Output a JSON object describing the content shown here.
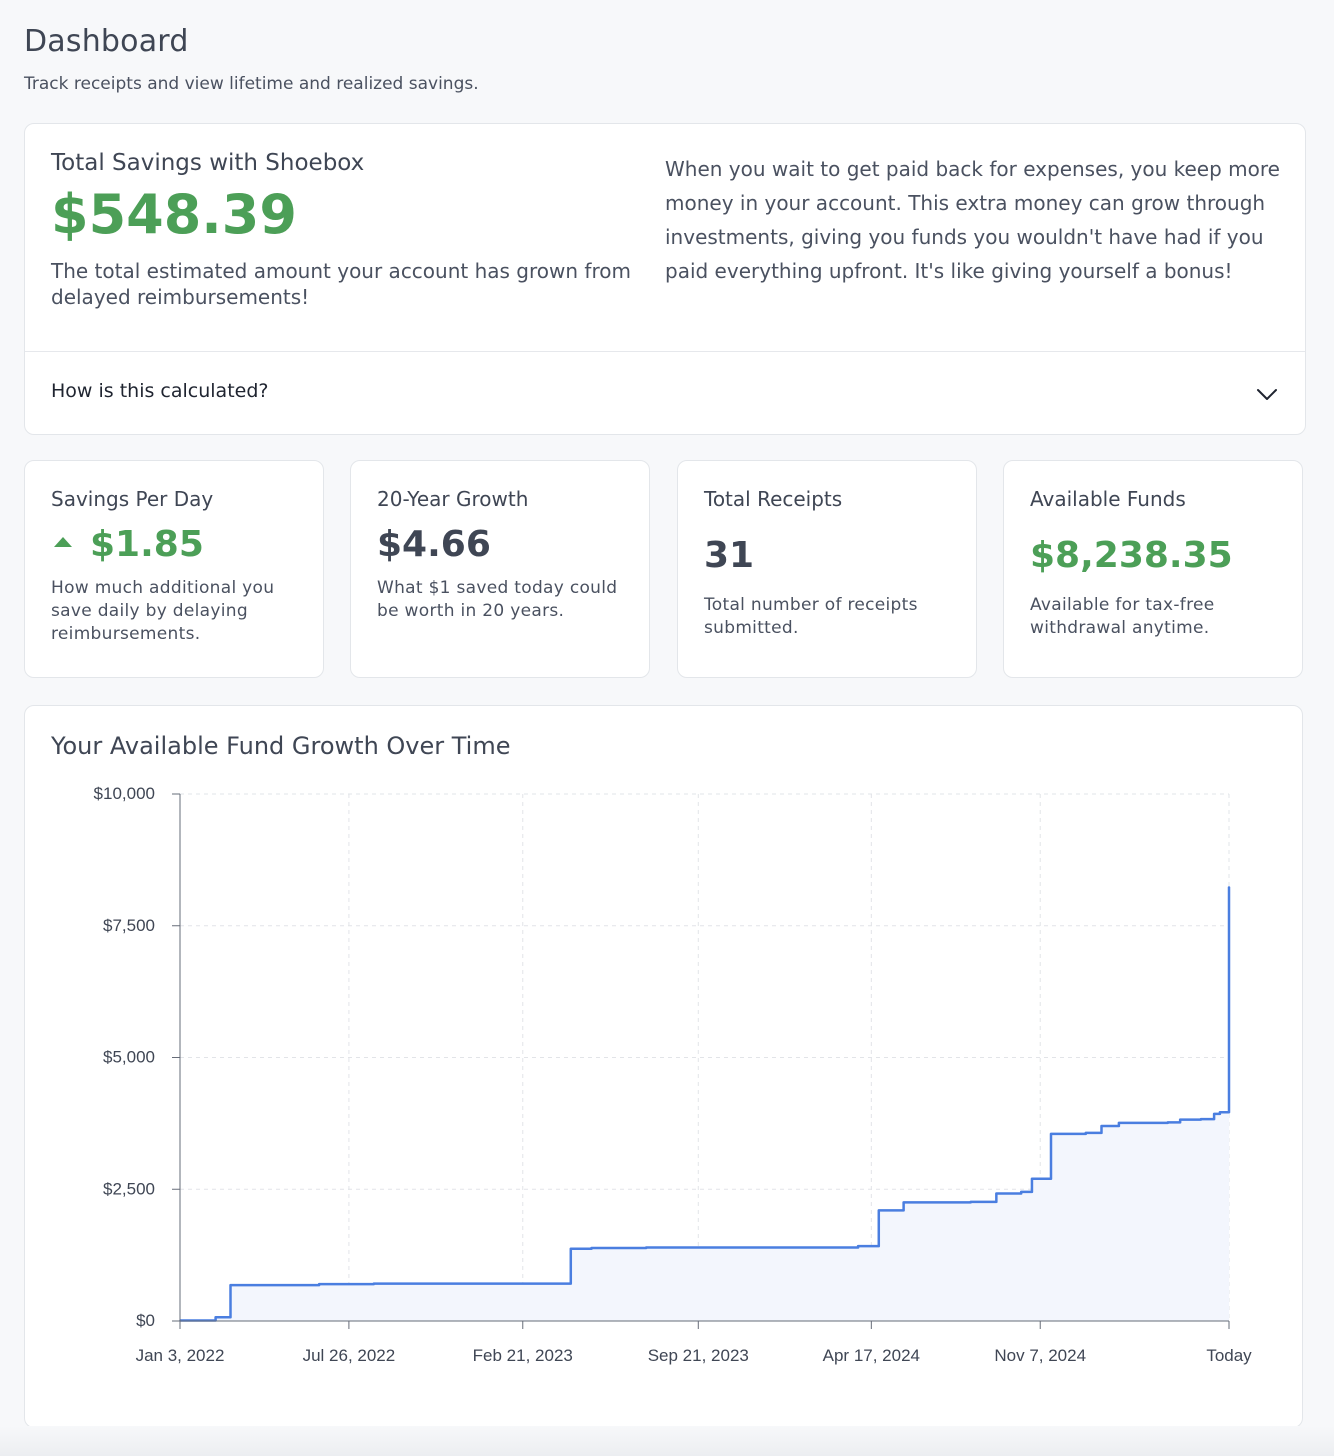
{
  "page": {
    "title": "Dashboard",
    "subtitle": "Track receipts and view lifetime and realized savings."
  },
  "hero": {
    "heading": "Total Savings with Shoebox",
    "amount": "$548.39",
    "description": "The total estimated amount your account has grown from delayed reimbursements!",
    "explanation": "When you wait to get paid back for expenses, you keep more money in your account. This extra money can grow through investments, giving you funds you wouldn't have had if you paid everything upfront. It's like giving yourself a bonus!",
    "accordion_label": "How is this calculated?",
    "accordion_icon": "chevron-down-icon"
  },
  "stats": [
    {
      "title": "Savings Per Day",
      "value": "$1.85",
      "description": "How much additional you save daily by delaying reimbursements.",
      "icon": "arrow-up-icon",
      "color": "#4c9f57"
    },
    {
      "title": "20-Year Growth",
      "value": "$4.66",
      "description": "What $1 saved today could be worth in 20 years.",
      "color": "#3f4654"
    },
    {
      "title": "Total Receipts",
      "value": "31",
      "description": "Total number of receipts submitted.",
      "color": "#3f4654"
    },
    {
      "title": "Available Funds",
      "value": "$8,238.35",
      "description": "Available for tax-free withdrawal anytime.",
      "color": "#4c9f57"
    }
  ],
  "chart": {
    "title": "Your Available Fund Growth Over Time"
  },
  "chart_data": {
    "type": "area",
    "title": "Your Available Fund Growth Over Time",
    "step": true,
    "grid": true,
    "line_color": "#4a7ee0",
    "fill_color": "#f3f6fd",
    "ylim": [
      0,
      10000
    ],
    "y_ticks": [
      0,
      2500,
      5000,
      7500,
      10000
    ],
    "y_tick_labels": [
      "$0",
      "$2,500",
      "$5,000",
      "$7,500",
      "$10,000"
    ],
    "x_ticks": [
      "2022-01-03",
      "2022-07-26",
      "2023-02-21",
      "2023-09-21",
      "2024-04-17",
      "2024-11-07",
      "2025-06-23"
    ],
    "x_tick_labels": [
      "Jan 3, 2022",
      "Jul 26, 2022",
      "Feb 21, 2023",
      "Sep 21, 2023",
      "Apr 17, 2024",
      "Nov 7, 2024",
      "Today"
    ],
    "points": [
      {
        "x": "2022-01-03",
        "y": 10
      },
      {
        "x": "2022-02-15",
        "y": 70
      },
      {
        "x": "2022-03-05",
        "y": 680
      },
      {
        "x": "2022-06-20",
        "y": 700
      },
      {
        "x": "2022-08-25",
        "y": 710
      },
      {
        "x": "2023-04-20",
        "y": 1370
      },
      {
        "x": "2023-05-15",
        "y": 1385
      },
      {
        "x": "2023-07-20",
        "y": 1395
      },
      {
        "x": "2024-04-01",
        "y": 1420
      },
      {
        "x": "2024-04-26",
        "y": 2100
      },
      {
        "x": "2024-05-26",
        "y": 2250
      },
      {
        "x": "2024-08-15",
        "y": 2260
      },
      {
        "x": "2024-09-15",
        "y": 2420
      },
      {
        "x": "2024-10-15",
        "y": 2450
      },
      {
        "x": "2024-10-28",
        "y": 2700
      },
      {
        "x": "2024-11-20",
        "y": 3550
      },
      {
        "x": "2025-01-01",
        "y": 3570
      },
      {
        "x": "2025-01-20",
        "y": 3700
      },
      {
        "x": "2025-02-10",
        "y": 3760
      },
      {
        "x": "2025-04-10",
        "y": 3770
      },
      {
        "x": "2025-04-25",
        "y": 3820
      },
      {
        "x": "2025-05-20",
        "y": 3830
      },
      {
        "x": "2025-06-05",
        "y": 3930
      },
      {
        "x": "2025-06-12",
        "y": 3960
      },
      {
        "x": "2025-06-23",
        "y": 8238.35
      }
    ]
  }
}
